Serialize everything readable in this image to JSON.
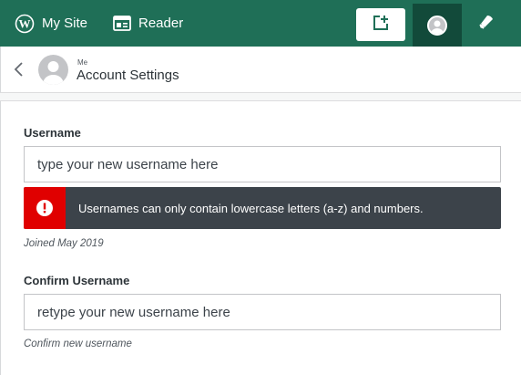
{
  "masterbar": {
    "my_site_label": "My Site",
    "reader_label": "Reader",
    "icons": [
      "wordpress-icon",
      "reader-icon",
      "write-icon",
      "avatar",
      "bell-icon"
    ],
    "background": "#1f6f57",
    "active_background": "#124a3a"
  },
  "header": {
    "subtitle": "Me",
    "title": "Account Settings"
  },
  "username": {
    "label": "Username",
    "placeholder": "type your new username here",
    "value": ""
  },
  "error_notice": {
    "text": "Usernames can only contain lowercase letters (a-z) and numbers.",
    "icon": "error-icon",
    "color": "#e00000"
  },
  "joined_text": "Joined May 2019",
  "confirm_username": {
    "label": "Confirm Username",
    "placeholder": "retype your new username here",
    "value": "",
    "help": "Confirm new username"
  }
}
